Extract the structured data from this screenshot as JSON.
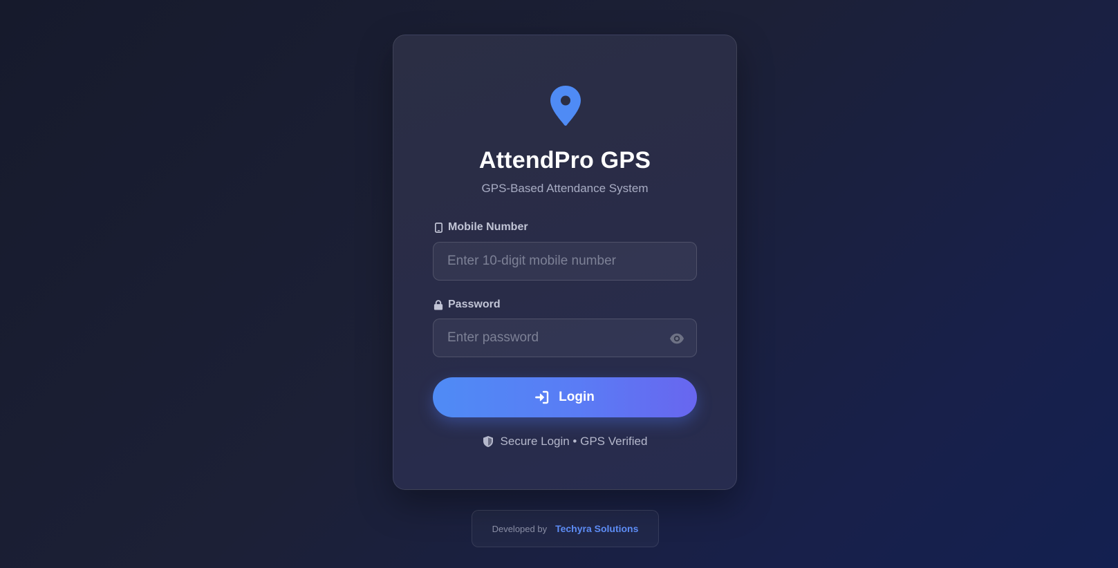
{
  "app": {
    "title": "AttendPro GPS",
    "subtitle": "GPS-Based Attendance System",
    "logo_icon": "map-pin-icon"
  },
  "form": {
    "mobile": {
      "label": "Mobile Number",
      "icon": "mobile-phone-icon",
      "placeholder": "Enter 10-digit mobile number",
      "value": ""
    },
    "password": {
      "label": "Password",
      "icon": "lock-icon",
      "placeholder": "Enter password",
      "value": "",
      "toggle_icon": "eye-icon"
    },
    "login_button": {
      "label": "Login",
      "icon": "sign-in-icon"
    },
    "secure_note": {
      "text": "Secure Login • GPS Verified",
      "icon": "shield-icon"
    }
  },
  "footer": {
    "prefix": "Developed by",
    "company": "Techyra Solutions"
  },
  "colors": {
    "accent": "#4f8bf5",
    "accent_end": "#6866ef",
    "company_link": "#5d8cf5",
    "background": "#1c2036",
    "card": "#2b2e44"
  }
}
